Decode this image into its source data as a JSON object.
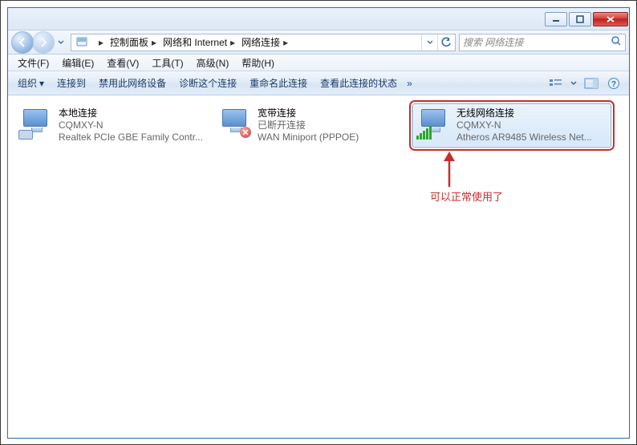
{
  "window_controls": {
    "minimize": "minimize",
    "maximize": "maximize",
    "close": "close"
  },
  "address": {
    "crumbs": [
      "控制面板",
      "网络和 Internet",
      "网络连接"
    ]
  },
  "search": {
    "placeholder": "搜索 网络连接"
  },
  "menus": {
    "items": [
      {
        "label": "文件(F)"
      },
      {
        "label": "编辑(E)"
      },
      {
        "label": "查看(V)"
      },
      {
        "label": "工具(T)"
      },
      {
        "label": "高级(N)"
      },
      {
        "label": "帮助(H)"
      }
    ]
  },
  "commands": {
    "items": [
      {
        "label": "组织",
        "dropdown": true
      },
      {
        "label": "连接到"
      },
      {
        "label": "禁用此网络设备"
      },
      {
        "label": "诊断这个连接"
      },
      {
        "label": "重命名此连接"
      },
      {
        "label": "查看此连接的状态"
      }
    ],
    "overflow": "»"
  },
  "connections": [
    {
      "name": "本地连接",
      "line2": "CQMXY-N",
      "line3": "Realtek PCIe GBE Family Contr...",
      "type": "lan",
      "selected": false,
      "highlighted": false
    },
    {
      "name": "宽带连接",
      "line2": "已断开连接",
      "line3": "WAN Miniport (PPPOE)",
      "type": "dialup",
      "selected": false,
      "highlighted": false
    },
    {
      "name": "无线网络连接",
      "line2": "CQMXY-N",
      "line3": "Atheros AR9485 Wireless Net...",
      "type": "wifi",
      "selected": true,
      "highlighted": true
    }
  ],
  "annotation": {
    "text": "可以正常使用了"
  }
}
